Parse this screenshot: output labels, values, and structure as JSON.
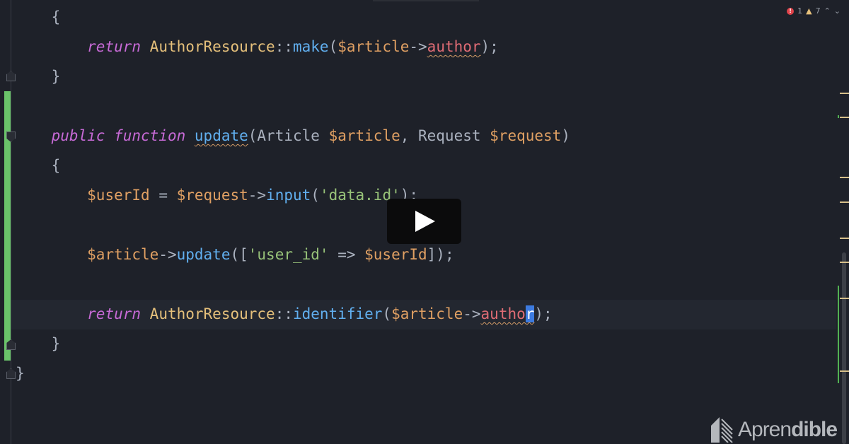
{
  "editor": {
    "lines": [
      [
        {
          "t": "    {",
          "c": "punc"
        }
      ],
      [
        {
          "t": "        "
        },
        {
          "t": "return",
          "c": "kw"
        },
        {
          "t": " "
        },
        {
          "t": "AuthorResource",
          "c": "cls"
        },
        {
          "t": "::",
          "c": "punc"
        },
        {
          "t": "make",
          "c": "fn"
        },
        {
          "t": "(",
          "c": "punc"
        },
        {
          "t": "$article",
          "c": "var"
        },
        {
          "t": "->",
          "c": "punc"
        },
        {
          "t": "author",
          "c": "prop squig"
        },
        {
          "t": ");",
          "c": "punc"
        }
      ],
      [
        {
          "t": "    }",
          "c": "punc"
        }
      ],
      [
        {
          "t": ""
        }
      ],
      [
        {
          "t": "    "
        },
        {
          "t": "public",
          "c": "kw"
        },
        {
          "t": " "
        },
        {
          "t": "function",
          "c": "kw"
        },
        {
          "t": " "
        },
        {
          "t": "update",
          "c": "fn squig"
        },
        {
          "t": "(Article ",
          "c": "punc"
        },
        {
          "t": "$article",
          "c": "var"
        },
        {
          "t": ", Request ",
          "c": "punc"
        },
        {
          "t": "$request",
          "c": "var"
        },
        {
          "t": ")",
          "c": "punc"
        }
      ],
      [
        {
          "t": "    {",
          "c": "punc"
        }
      ],
      [
        {
          "t": "        "
        },
        {
          "t": "$userId",
          "c": "var"
        },
        {
          "t": " = ",
          "c": "punc"
        },
        {
          "t": "$request",
          "c": "var"
        },
        {
          "t": "->",
          "c": "punc"
        },
        {
          "t": "input",
          "c": "fn"
        },
        {
          "t": "(",
          "c": "punc"
        },
        {
          "t": "'data.id'",
          "c": "str"
        },
        {
          "t": ");",
          "c": "punc"
        }
      ],
      [
        {
          "t": ""
        }
      ],
      [
        {
          "t": "        "
        },
        {
          "t": "$article",
          "c": "var"
        },
        {
          "t": "->",
          "c": "punc"
        },
        {
          "t": "update",
          "c": "fn"
        },
        {
          "t": "([",
          "c": "punc"
        },
        {
          "t": "'user_id'",
          "c": "str"
        },
        {
          "t": " => ",
          "c": "punc"
        },
        {
          "t": "$userId",
          "c": "var"
        },
        {
          "t": "]);",
          "c": "punc"
        }
      ],
      [
        {
          "t": ""
        }
      ],
      [
        {
          "t": "        "
        },
        {
          "t": "return",
          "c": "kw"
        },
        {
          "t": " "
        },
        {
          "t": "AuthorResource",
          "c": "cls"
        },
        {
          "t": "::",
          "c": "punc"
        },
        {
          "t": "identifier",
          "c": "fn"
        },
        {
          "t": "(",
          "c": "punc"
        },
        {
          "t": "$article",
          "c": "var"
        },
        {
          "t": "->",
          "c": "punc"
        },
        {
          "t": "autho",
          "c": "prop squig"
        },
        {
          "t": "r",
          "c": "caret squig"
        },
        {
          "t": ");",
          "c": "punc"
        }
      ],
      [
        {
          "t": "    }",
          "c": "punc"
        }
      ],
      [
        {
          "t": "}",
          "c": "punc"
        }
      ]
    ]
  },
  "status": {
    "errors": "1",
    "warnings": "7",
    "up": "⌃",
    "down": "⌄"
  },
  "logo": {
    "light": "Apren",
    "bold": "dible"
  }
}
